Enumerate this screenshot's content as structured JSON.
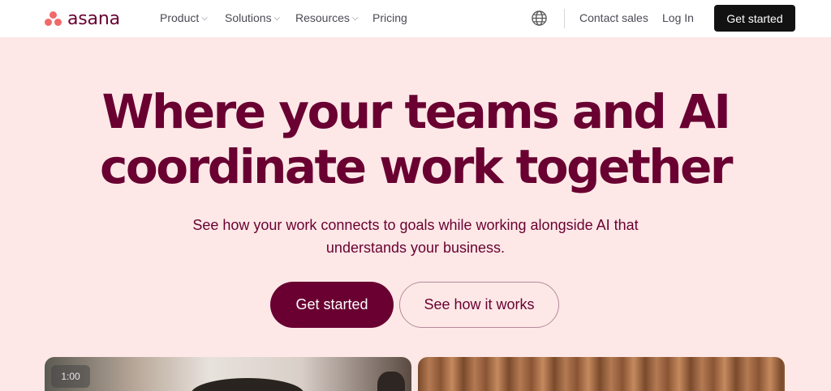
{
  "nav": {
    "brand": "asana",
    "items": [
      {
        "label": "Product",
        "has_dropdown": true
      },
      {
        "label": "Solutions",
        "has_dropdown": true
      },
      {
        "label": "Resources",
        "has_dropdown": true
      },
      {
        "label": "Pricing",
        "has_dropdown": false
      }
    ],
    "globe_icon": "globe-icon",
    "contact_sales": "Contact sales",
    "log_in": "Log In",
    "get_started": "Get started"
  },
  "hero": {
    "title_line1": "Where your teams and AI",
    "title_line2": "coordinate work together",
    "subtitle_line1": "See how your work connects to goals while working alongside AI that",
    "subtitle_line2": "understands your business.",
    "primary_cta": "Get started",
    "secondary_cta": "See how it works"
  },
  "media": {
    "video_timestamp": "1:00"
  },
  "colors": {
    "brand_dark": "#690031",
    "logo_coral": "#f06a6a",
    "hero_bg": "#fde8e7",
    "nav_button_bg": "#121212"
  }
}
